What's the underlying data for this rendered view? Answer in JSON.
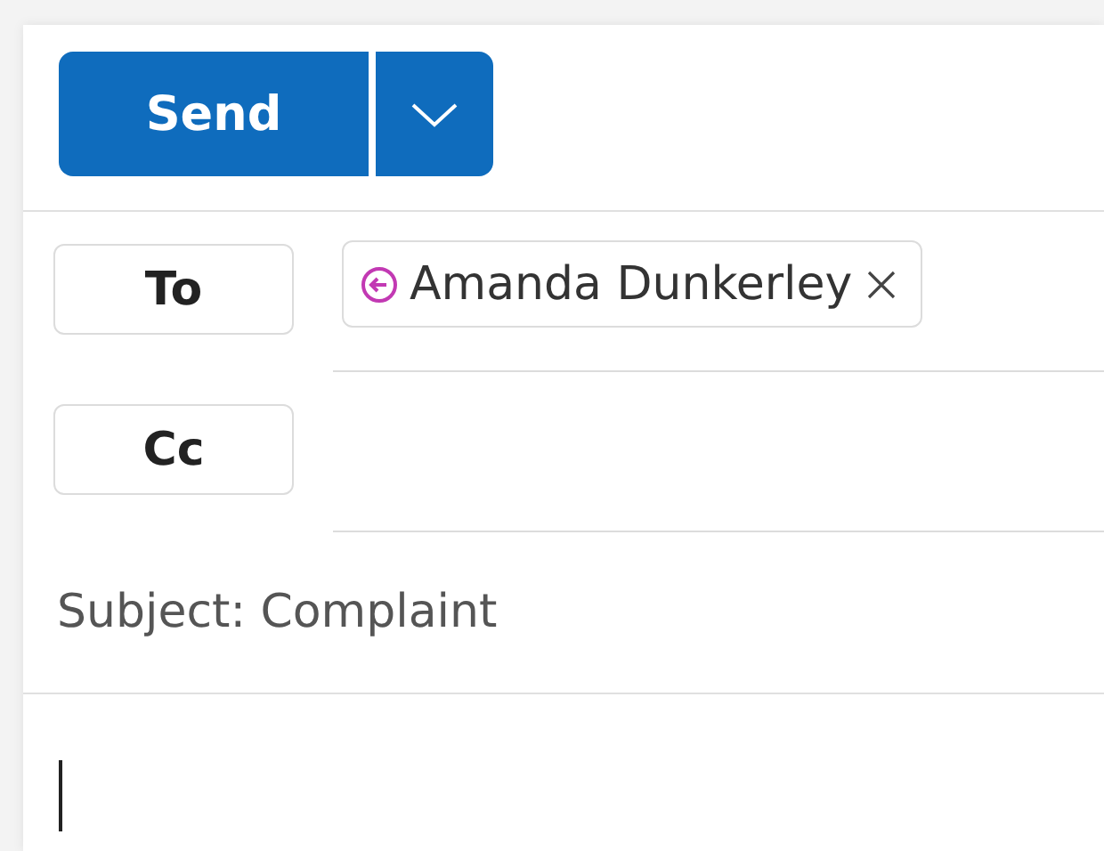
{
  "send_button": {
    "label": "Send"
  },
  "to": {
    "label": "To",
    "recipients": [
      {
        "name": "Amanda Dunkerley"
      }
    ]
  },
  "cc": {
    "label": "Cc"
  },
  "subject": {
    "value": "Subject: Complaint"
  }
}
